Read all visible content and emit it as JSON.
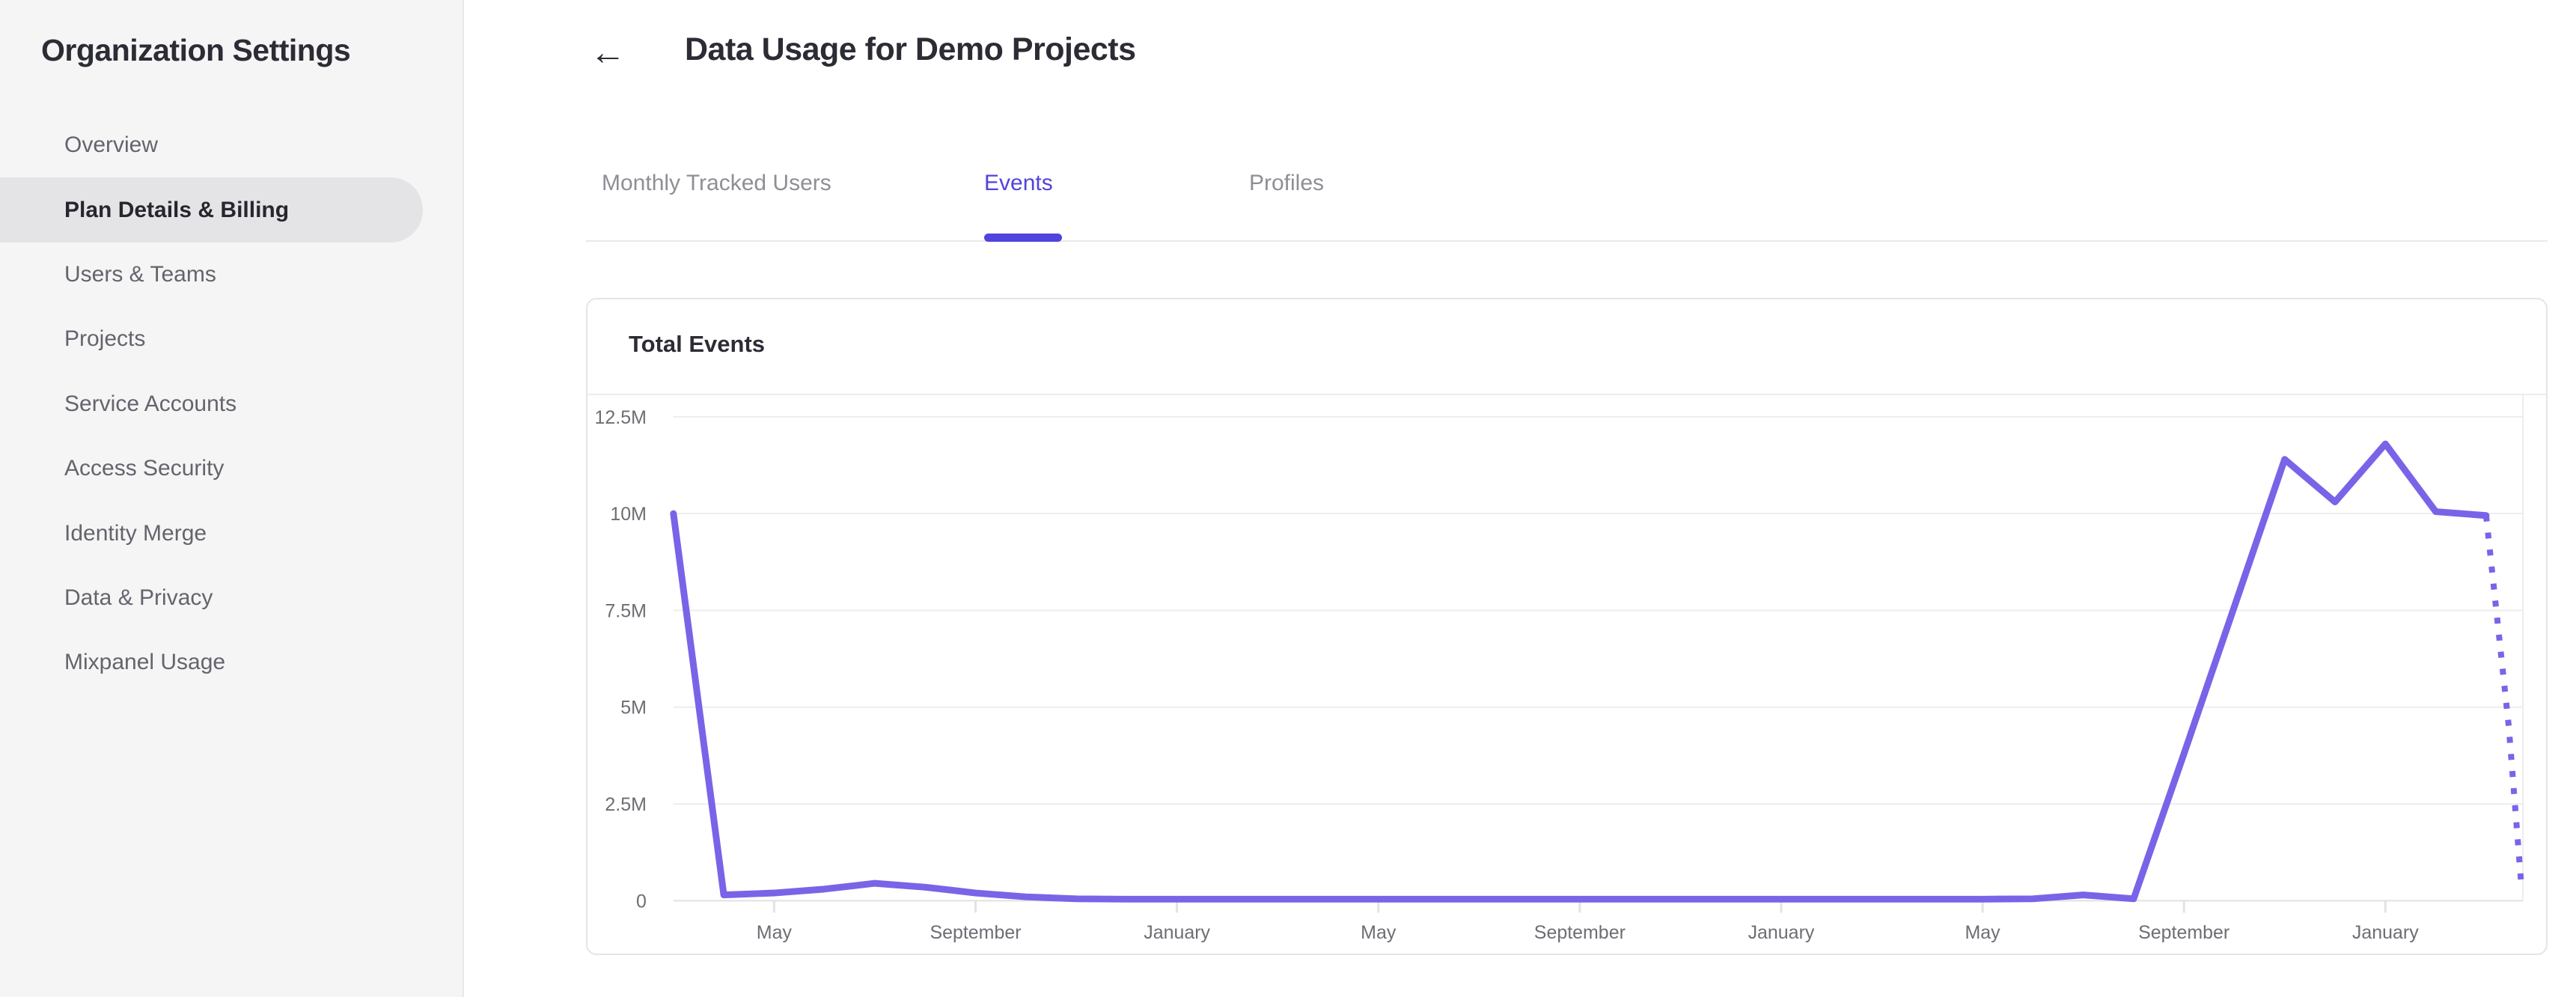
{
  "sidebar": {
    "title": "Organization Settings",
    "items": [
      {
        "label": "Overview",
        "selected": false
      },
      {
        "label": "Plan Details & Billing",
        "selected": true
      },
      {
        "label": "Users & Teams",
        "selected": false
      },
      {
        "label": "Projects",
        "selected": false
      },
      {
        "label": "Service Accounts",
        "selected": false
      },
      {
        "label": "Access Security",
        "selected": false
      },
      {
        "label": "Identity Merge",
        "selected": false
      },
      {
        "label": "Data & Privacy",
        "selected": false
      },
      {
        "label": "Mixpanel Usage",
        "selected": false
      }
    ]
  },
  "header": {
    "back_icon": "←",
    "title": "Data Usage for Demo Projects"
  },
  "tabs": [
    {
      "label": "Monthly Tracked Users",
      "active": false
    },
    {
      "label": "Events",
      "active": true
    },
    {
      "label": "Profiles",
      "active": false
    }
  ],
  "card": {
    "title": "Total Events"
  },
  "colors": {
    "accent_purple": "#5143dd",
    "line_purple": "#7b63e8",
    "dark_text": "#2c2c35",
    "axis_label": "#6d6d74",
    "gridline": "#ededef",
    "axis_line": "#e0e0e3",
    "tick_mark": "#e3e3e6",
    "sidebar_bg": "#f5f5f6",
    "pill_bg": "#e4e4e6"
  },
  "chart_data": {
    "type": "line",
    "title": "Total Events",
    "ylabel": "",
    "xlabel": "",
    "ylim": [
      0,
      12.5
    ],
    "grid": "horizontal",
    "legend": "none",
    "y_ticks": [
      {
        "label": "12.5M",
        "value": 12.5
      },
      {
        "label": "10M",
        "value": 10
      },
      {
        "label": "7.5M",
        "value": 7.5
      },
      {
        "label": "5M",
        "value": 5
      },
      {
        "label": "2.5M",
        "value": 2.5
      },
      {
        "label": "0",
        "value": 0
      }
    ],
    "x_ticks": [
      {
        "label": "May",
        "month": 2
      },
      {
        "label": "September",
        "month": 6
      },
      {
        "label": "January",
        "month": 10
      },
      {
        "label": "May",
        "month": 14
      },
      {
        "label": "September",
        "month": 18
      },
      {
        "label": "January",
        "month": 22
      },
      {
        "label": "May",
        "month": 26
      },
      {
        "label": "September",
        "month": 30
      },
      {
        "label": "January",
        "month": 34
      }
    ],
    "series": [
      {
        "name": "Total Events",
        "unit": "millions",
        "start_month_index": 0,
        "values_millions": [
          10,
          0.15,
          0.2,
          0.3,
          0.45,
          0.35,
          0.2,
          0.1,
          0.05,
          0.04,
          0.04,
          0.04,
          0.04,
          0.04,
          0.04,
          0.04,
          0.04,
          0.04,
          0.04,
          0.04,
          0.04,
          0.04,
          0.04,
          0.04,
          0.04,
          0.04,
          0.04,
          0.05,
          0.15,
          0.05,
          3.8,
          7.6,
          11.4,
          10.3,
          11.8,
          10.05,
          9.95
        ]
      }
    ],
    "projection_dotted": {
      "style": "dotted",
      "points_month_value": [
        [
          36,
          9.95
        ],
        [
          36.45,
          4.5
        ],
        [
          36.7,
          0.4
        ]
      ]
    }
  }
}
